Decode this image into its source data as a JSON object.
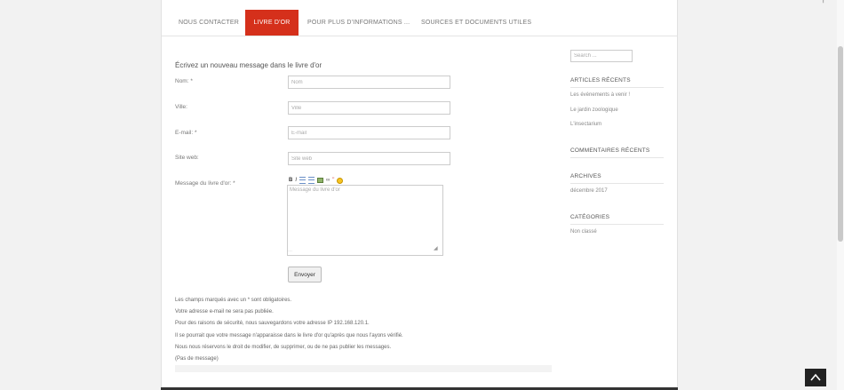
{
  "nav": {
    "items": [
      {
        "label": "NOUS CONTACTER"
      },
      {
        "label": "LIVRE D'OR"
      },
      {
        "label": "POUR PLUS D'INFORMATIONS ..."
      },
      {
        "label": "SOURCES ET DOCUMENTS UTILES"
      }
    ],
    "active_index": 1
  },
  "form": {
    "title": "Écrivez un nouveau message dans le livre d'or",
    "fields": {
      "nom": {
        "label": "Nom: *",
        "placeholder": "Nom"
      },
      "ville": {
        "label": "Ville:",
        "placeholder": "Ville"
      },
      "email": {
        "label": "E-mail: *",
        "placeholder": "E-mail"
      },
      "site": {
        "label": "Site web:",
        "placeholder": "Site web"
      },
      "message": {
        "label": "Message du livre d'or: *",
        "placeholder": "Message du livre d'or"
      }
    },
    "toolbar": {
      "bold": "B",
      "italic": "I",
      "link": "∞",
      "quote": "\""
    },
    "submit_label": "Envoyer"
  },
  "notes": [
    "Les champs marqués avec un * sont obligatoires.",
    "Votre adresse e-mail ne sera pas publiée.",
    "Pour des raisons de sécurité, nous sauvegardons votre adresse IP 192.168.120.1.",
    "Il se pourrait que votre message n'apparaisse dans le livre d'or qu'après que nous l'ayons vérifié.",
    "Nous nous réservons le droit de modifier, de supprimer, ou de ne pas publier les messages.",
    "(Pas de message)"
  ],
  "sidebar": {
    "search_placeholder": "Search ...",
    "recent_posts": {
      "title": "ARTICLES RÉCENTS",
      "items": [
        "Les événements à venir !",
        "Le jardin zoologique",
        "L'insectarium"
      ]
    },
    "recent_comments": {
      "title": "COMMENTAIRES RÉCENTS"
    },
    "archives": {
      "title": "ARCHIVES",
      "items": [
        "décembre 2017"
      ]
    },
    "categories": {
      "title": "CATÉGORIES",
      "items": [
        "Non classé"
      ]
    }
  },
  "colors": {
    "accent": "#d5301b",
    "page_bg": "#f2f2f2",
    "text": "#555555"
  },
  "icons": {
    "back_to_top": "chevron-up-icon",
    "search": "search-icon"
  }
}
